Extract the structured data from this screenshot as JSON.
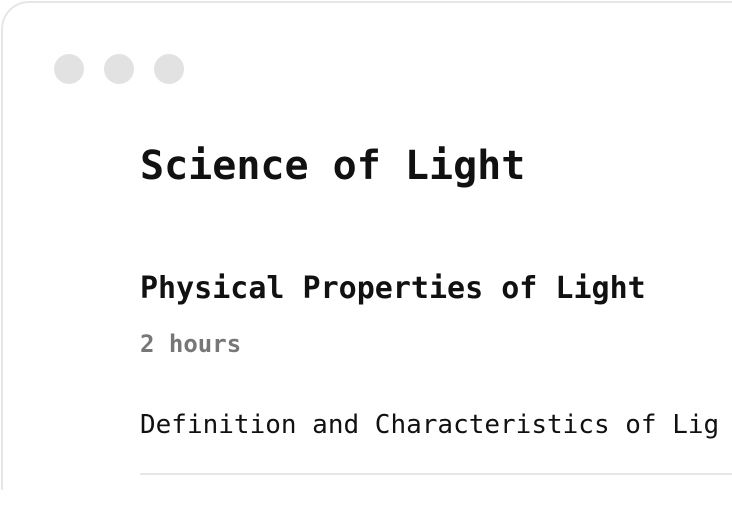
{
  "window": {
    "controls": [
      "close",
      "minimize",
      "maximize"
    ]
  },
  "course": {
    "title": "Science of Light"
  },
  "module": {
    "title": "Physical Properties of Light",
    "duration": "2 hours",
    "topics": [
      "Definition and Characteristics of Lig"
    ]
  }
}
